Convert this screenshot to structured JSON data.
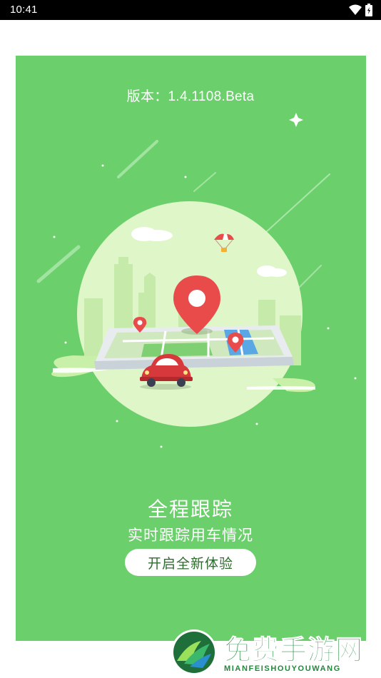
{
  "status_bar": {
    "time": "10:41",
    "wifi_icon": "wifi-icon",
    "battery_icon": "battery-icon"
  },
  "splash": {
    "version_text": "版本：1.4.1108.Beta",
    "title": "全程跟踪",
    "subtitle": "实时跟踪用车情况",
    "start_button": "开启全新体验",
    "illustration_icons": [
      "map-pin-icon",
      "car-icon",
      "parachute-icon",
      "phone-map-icon",
      "sparkle-icon"
    ]
  },
  "watermark": {
    "title": "免费手游网",
    "subtitle": "MIANFEISHOUYOUWANG",
    "logo_icon": "mountain-logo-icon"
  },
  "colors": {
    "card_green": "#6bd06b",
    "pin_red": "#e94b4b",
    "watermark_green": "#1e8a3a"
  }
}
